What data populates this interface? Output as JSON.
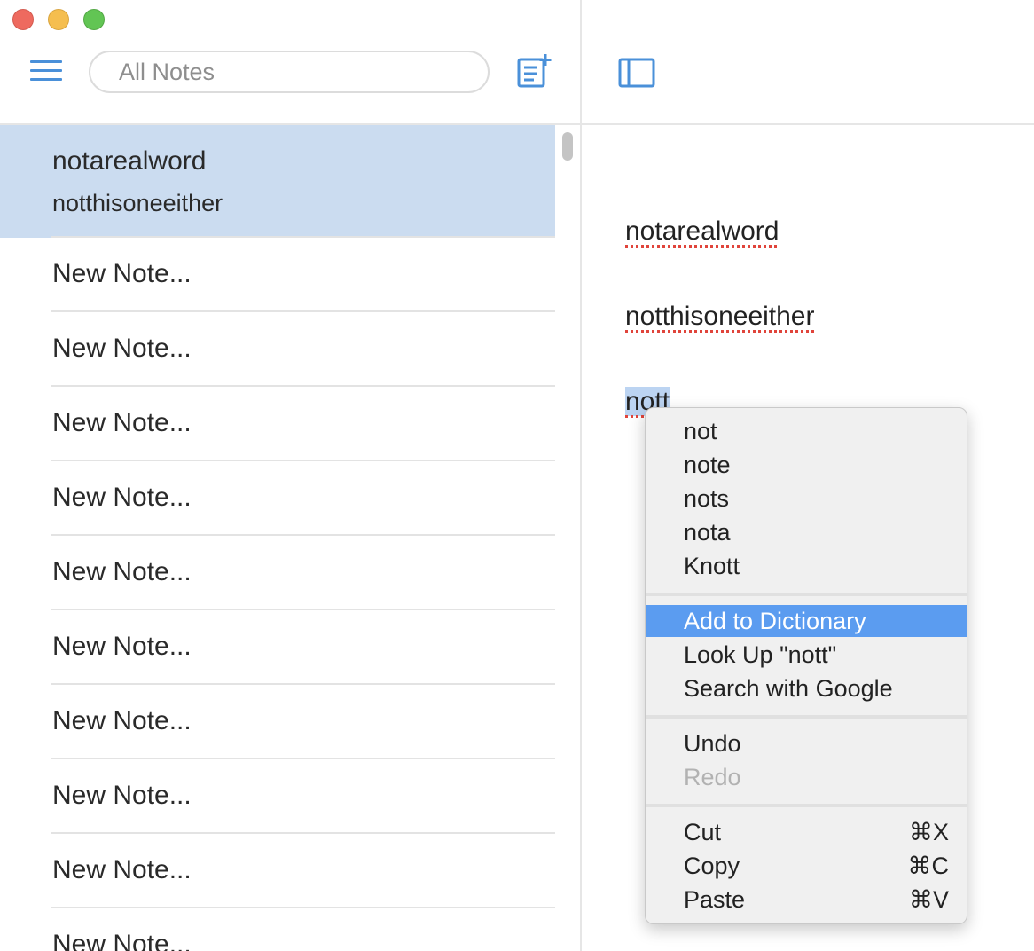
{
  "window": {
    "traffic_lights": [
      "close",
      "minimize",
      "zoom"
    ]
  },
  "toolbar": {
    "search_placeholder": "All Notes",
    "menu_icon": "hamburger-icon",
    "new_note_icon": "new-note-icon",
    "sidebar_toggle_icon": "sidebar-toggle-icon"
  },
  "notes": [
    {
      "title": "notarealword",
      "preview": "notthisoneeither",
      "selected": true
    },
    {
      "title": "New Note..."
    },
    {
      "title": "New Note..."
    },
    {
      "title": "New Note..."
    },
    {
      "title": "New Note..."
    },
    {
      "title": "New Note..."
    },
    {
      "title": "New Note..."
    },
    {
      "title": "New Note..."
    },
    {
      "title": "New Note..."
    },
    {
      "title": "New Note..."
    },
    {
      "title": "New Note..."
    }
  ],
  "editor": {
    "lines": [
      "notarealword",
      "notthisoneeither",
      "nott"
    ]
  },
  "context_menu": {
    "suggestions": [
      "not",
      "note",
      "nots",
      "nota",
      "Knott"
    ],
    "actions": [
      {
        "label": "Add to Dictionary",
        "highlighted": true
      },
      {
        "label": "Look Up \"nott\""
      },
      {
        "label": "Search with Google"
      }
    ],
    "history": [
      {
        "label": "Undo"
      },
      {
        "label": "Redo",
        "disabled": true
      }
    ],
    "clipboard": [
      {
        "label": "Cut",
        "shortcut": "⌘X"
      },
      {
        "label": "Copy",
        "shortcut": "⌘C"
      },
      {
        "label": "Paste",
        "shortcut": "⌘V"
      }
    ]
  },
  "colors": {
    "accent": "#4a90d9",
    "selection": "#cbdcf0",
    "menu_highlight": "#5b9cf0",
    "spelling_underline": "#e0443b"
  }
}
